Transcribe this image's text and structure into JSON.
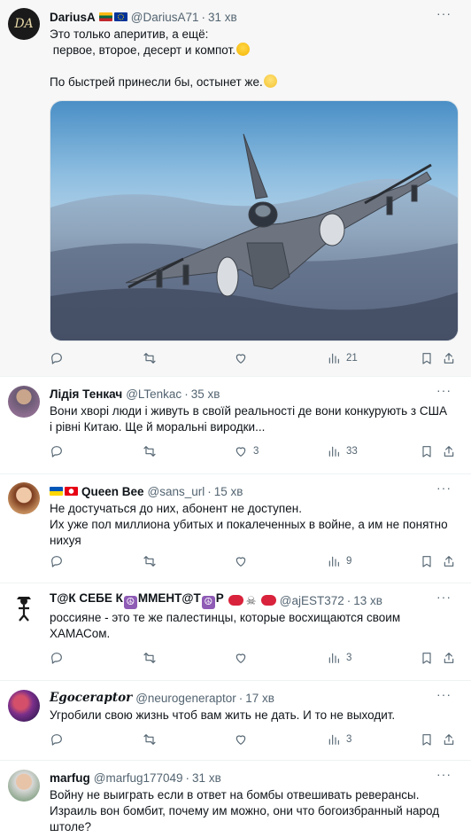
{
  "colors": {
    "text": "#0f1419",
    "muted": "#536471",
    "divider": "#eff3f4",
    "first_post_bg": "#f7f7f7"
  },
  "posts": [
    {
      "name": "DariusA",
      "handle": "@DariusA71",
      "dot": "·",
      "time": "31 хв",
      "avatar_text": "DA",
      "flags": [
        "lithuania-flag",
        "eu-flag"
      ],
      "text_lines": [
        "Это только аперитив, а ещё:",
        " первое, второе, десерт и компот."
      ],
      "text_lines_2": [
        "По быстрей принесли бы, остынет же."
      ],
      "emojis": [
        "grinning-face-emoji",
        "thinking-face-emoji"
      ],
      "media": "fighter-jet-photo",
      "replies": "",
      "reposts": "",
      "likes": "",
      "views": "21"
    },
    {
      "name": "Лідія Тенкач",
      "handle": "@LTenkac",
      "dot": "·",
      "time": "35 хв",
      "text_lines": [
        "Вони хворі люди і живуть в своїй реальності де вони конкурують з США",
        "і рівні Китаю. Ще й моральні виродки..."
      ],
      "replies": "",
      "reposts": "",
      "likes": "3",
      "views": "33"
    },
    {
      "name": "Queen Bee",
      "handle": "@sans_url",
      "dot": "·",
      "time": "15 хв",
      "flags": [
        "ukraine-flag",
        "tunisia-flag"
      ],
      "text_lines": [
        "Не достучаться до них, абонент не доступен.",
        "Их уже пол миллиона убитых и покалеченных в войне, а им не понятно",
        "нихуя"
      ],
      "replies": "",
      "reposts": "",
      "likes": "",
      "views": "9"
    },
    {
      "name_parts": [
        "Т@К СЕБЕ К",
        "ММЕНТ@Т",
        "Р"
      ],
      "handle": "@ajEST372",
      "dot": "·",
      "time": "13 хв",
      "text_lines": [
        "россияне - это те же палестинцы, которые восхищаются своим",
        "ХАМАСом."
      ],
      "replies": "",
      "reposts": "",
      "likes": "",
      "views": "3"
    },
    {
      "name": "Egoceraptor",
      "handle": "@neurogeneraptor",
      "dot": "·",
      "time": "17 хв",
      "text_lines": [
        "Угробили свою жизнь чтоб вам жить не дать. И то не выходит."
      ],
      "replies": "",
      "reposts": "",
      "likes": "",
      "views": "3"
    },
    {
      "name": "marfug",
      "handle": "@marfug177049",
      "dot": "·",
      "time": "31 хв",
      "text_lines": [
        "Войну не выиграть если в ответ на бомбы отвешивать реверансы.",
        "Израиль вон бомбит, почему им можно, они что богоизбранный народ",
        "штоле?"
      ]
    }
  ]
}
